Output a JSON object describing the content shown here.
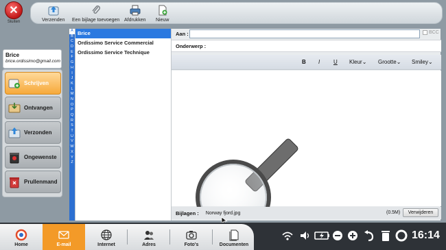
{
  "toolbar": {
    "close_label": "Sluiten",
    "send_label": "Verzenden",
    "attach_label": "Een bijlage toevoegen",
    "print_label": "Afdrukken",
    "new_label": "Nieuw"
  },
  "user": {
    "name": "Brice",
    "email": "brice.ordissimo@gmail.com"
  },
  "folders": [
    {
      "label": "Schrijven",
      "icon": "write-icon"
    },
    {
      "label": "Ontvangen",
      "icon": "inbox-icon"
    },
    {
      "label": "Verzonden",
      "icon": "sent-icon"
    },
    {
      "label": "Ongewenste",
      "icon": "junk-icon"
    },
    {
      "label": "Prullenmand",
      "icon": "trash-icon"
    }
  ],
  "alphabet": [
    "A",
    "B",
    "C",
    "D",
    "E",
    "F",
    "G",
    "H",
    "I",
    "J",
    "K",
    "L",
    "M",
    "N",
    "O",
    "P",
    "Q",
    "R",
    "S",
    "T",
    "U",
    "V",
    "W",
    "X",
    "Y",
    "Z"
  ],
  "contacts": [
    "Brice",
    "Ordissimo Service Commercial",
    "Ordissimo Service Technique"
  ],
  "compose": {
    "to_label": "Aan :",
    "to_value": "",
    "bcc_label": "BCC",
    "subject_label": "Onderwerp :",
    "format": {
      "bold": "B",
      "italic": "I",
      "underline": "U",
      "color": "Kleur",
      "size": "Grootte",
      "smiley": "Smiley"
    },
    "attach_label": "Bijlagen :",
    "attach_file": "Norway fjord.jpg",
    "attach_size": "(0.5M)",
    "remove_label": "Verwijderen"
  },
  "taskbar": {
    "items": [
      {
        "label": "Home",
        "icon": "home-icon"
      },
      {
        "label": "E-mail",
        "icon": "email-icon"
      },
      {
        "label": "Internet",
        "icon": "globe-icon"
      },
      {
        "label": "Adres",
        "icon": "contacts-icon"
      },
      {
        "label": "Foto's",
        "icon": "camera-icon"
      },
      {
        "label": "Documenten",
        "icon": "documents-icon"
      }
    ],
    "clock": "16:14"
  },
  "colors": {
    "accent_orange": "#f39a28",
    "selection_blue": "#2b79e0",
    "alpha_blue": "#2c6fd1"
  }
}
